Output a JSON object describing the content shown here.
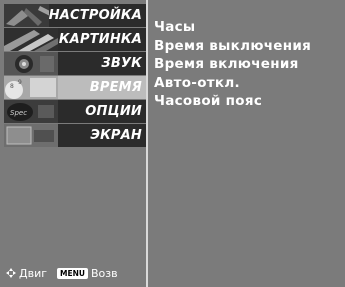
{
  "menu": {
    "items": [
      {
        "label": "НАСТРОЙКА",
        "icon": "setup-icon",
        "selected": false
      },
      {
        "label": "КАРТИНКА",
        "icon": "picture-icon",
        "selected": false
      },
      {
        "label": "ЗВУК",
        "icon": "audio-icon",
        "selected": false
      },
      {
        "label": "ВРЕМЯ",
        "icon": "time-icon",
        "selected": true
      },
      {
        "label": "ОПЦИИ",
        "icon": "option-icon",
        "selected": false
      },
      {
        "label": "ЭКРАН",
        "icon": "screen-icon",
        "selected": false
      }
    ]
  },
  "submenu": {
    "options": [
      "Часы",
      "Время выключения",
      "Время включения",
      "Авто-откл.",
      "Часовой пояс"
    ]
  },
  "footer": {
    "move_label": "Двиг",
    "menu_badge": "MENU",
    "back_label": "Возв"
  },
  "colors": {
    "panel_bg": "#7b7b7b",
    "item_bg": "#2b2b2b",
    "selected_bg": "#bcbcbc",
    "text": "#ffffff"
  }
}
